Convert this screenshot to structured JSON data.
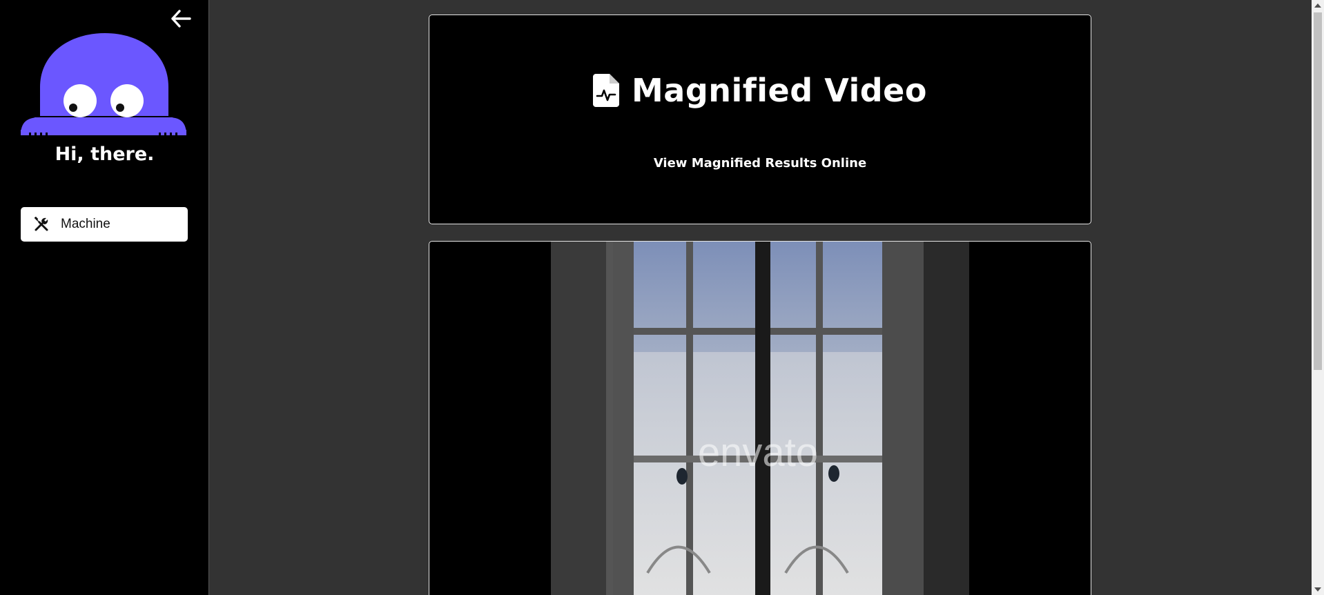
{
  "sidebar": {
    "greeting": "Hi, there.",
    "nav_items": [
      {
        "label": "Machine",
        "icon": "tools-icon"
      }
    ],
    "back_icon": "arrow-left-icon",
    "mascot_color": "#6b57ff"
  },
  "main": {
    "header": {
      "title": "Magnified Video",
      "title_icon": "file-waveform-icon",
      "link_text": "View Magnified Results Online"
    },
    "video": {
      "watermark": "envato"
    }
  },
  "colors": {
    "sidebar_bg": "#000000",
    "main_bg": "#333333",
    "card_bg": "#000000",
    "accent": "#6b57ff"
  }
}
